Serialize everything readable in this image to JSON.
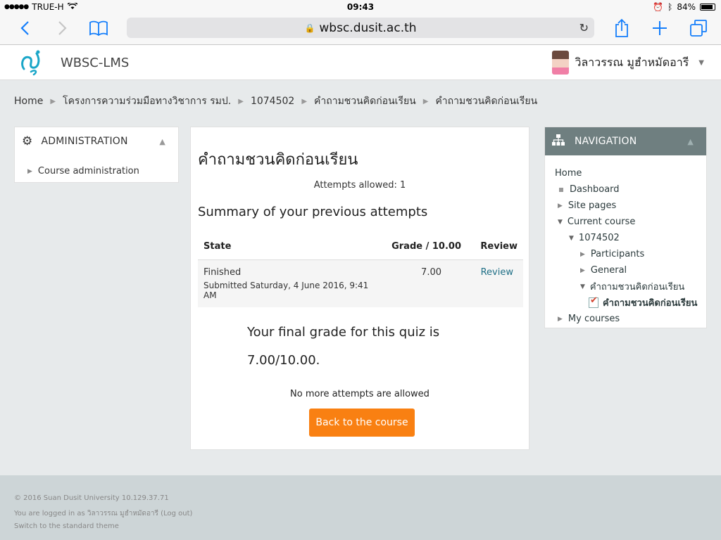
{
  "status_bar": {
    "carrier": "TRUE-H",
    "time": "09:43",
    "battery": "84%"
  },
  "browser": {
    "url": "wbsc.dusit.ac.th"
  },
  "header": {
    "site_name": "WBSC-LMS",
    "user_name": "วิลาวรรณ มูฮำหมัดอารี"
  },
  "breadcrumb": [
    "Home",
    "โครงการความร่วมมือทางวิชาการ รมป.",
    "1074502",
    "คำถามชวนคิดก่อนเรียน",
    "คำถามชวนคิดก่อนเรียน"
  ],
  "admin_block": {
    "title": "ADMINISTRATION",
    "item": "Course administration"
  },
  "nav_block": {
    "title": "NAVIGATION",
    "home": "Home",
    "dashboard": "Dashboard",
    "site_pages": "Site pages",
    "current_course": "Current course",
    "course_code": "1074502",
    "participants": "Participants",
    "general": "General",
    "section": "คำถามชวนคิดก่อนเรียน",
    "quiz": "คำถามชวนคิดก่อนเรียน",
    "my_courses": "My courses"
  },
  "main": {
    "title": "คำถามชวนคิดก่อนเรียน",
    "attempts_allowed": "Attempts allowed: 1",
    "summary_title": "Summary of your previous attempts",
    "table": {
      "headers": [
        "State",
        "Grade / 10.00",
        "Review"
      ],
      "rows": [
        {
          "state": "Finished",
          "submitted": "Submitted Saturday, 4 June 2016, 9:41 AM",
          "grade": "7.00",
          "review": "Review"
        }
      ]
    },
    "final_grade_line1": "Your final grade for this quiz is",
    "final_grade_line2": "7.00/10.00.",
    "no_more": "No more attempts are allowed",
    "back_button": "Back to the course"
  },
  "footer": {
    "copyright": "© 2016 Suan Dusit University 10.129.37.71",
    "logged_in": "You are logged in as วิลาวรรณ มูฮำหมัดอารี (Log out)",
    "theme": "Switch to the standard theme"
  },
  "colors": {
    "accent_button": "#f98012",
    "nav_header": "#6f7f80",
    "link": "#1f6f86"
  }
}
